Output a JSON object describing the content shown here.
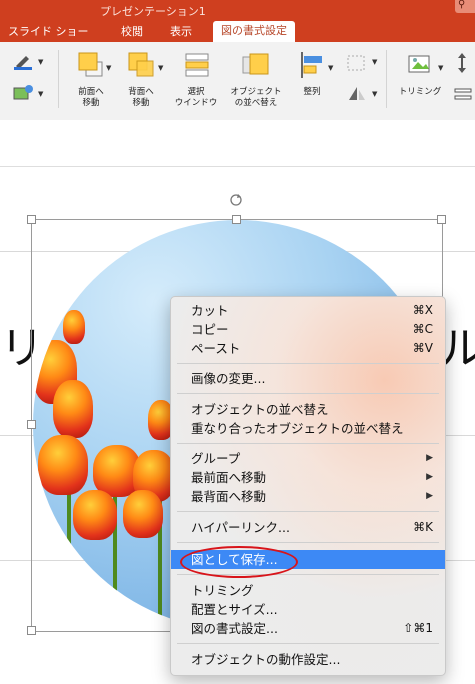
{
  "window": {
    "title": "プレゼンテーション1"
  },
  "tabs": [
    {
      "label": "スライド ショー",
      "active": false
    },
    {
      "label": "校閲",
      "active": false
    },
    {
      "label": "表示",
      "active": false
    },
    {
      "label": "図の書式設定",
      "active": true
    }
  ],
  "ribbon": {
    "buttons": [
      {
        "label": "前面へ\n移動",
        "icon": "bring-forward-icon"
      },
      {
        "label": "背面へ\n移動",
        "icon": "send-backward-icon"
      },
      {
        "label": "選択\nウインドウ",
        "icon": "selection-pane-icon"
      },
      {
        "label": "オブジェクト\nの並べ替え",
        "icon": "reorder-objects-icon"
      },
      {
        "label": "整列",
        "icon": "align-icon"
      },
      {
        "label": "トリミング",
        "icon": "crop-icon"
      }
    ]
  },
  "slide": {
    "partial_text_left": "リ",
    "partial_text_right": "ル"
  },
  "context_menu": {
    "items": [
      {
        "label": "カット",
        "shortcut": "⌘X"
      },
      {
        "label": "コピー",
        "shortcut": "⌘C"
      },
      {
        "label": "ペースト",
        "shortcut": "⌘V"
      },
      {
        "label": "画像の変更..."
      },
      {
        "label": "オブジェクトの並べ替え"
      },
      {
        "label": "重なり合ったオブジェクトの並べ替え"
      },
      {
        "label": "グループ",
        "submenu": true
      },
      {
        "label": "最前面へ移動",
        "submenu": true
      },
      {
        "label": "最背面へ移動",
        "submenu": true
      },
      {
        "label": "ハイパーリンク...",
        "shortcut": "⌘K"
      },
      {
        "label": "図として保存...",
        "highlighted": true
      },
      {
        "label": "トリミング"
      },
      {
        "label": "配置とサイズ..."
      },
      {
        "label": "図の書式設定...",
        "shortcut": "⇧⌘1"
      },
      {
        "label": "オブジェクトの動作設定..."
      }
    ]
  },
  "colors": {
    "accent": "#cf3f1f",
    "menu_highlight": "#3d89f5",
    "annotation": "#d8141a"
  }
}
